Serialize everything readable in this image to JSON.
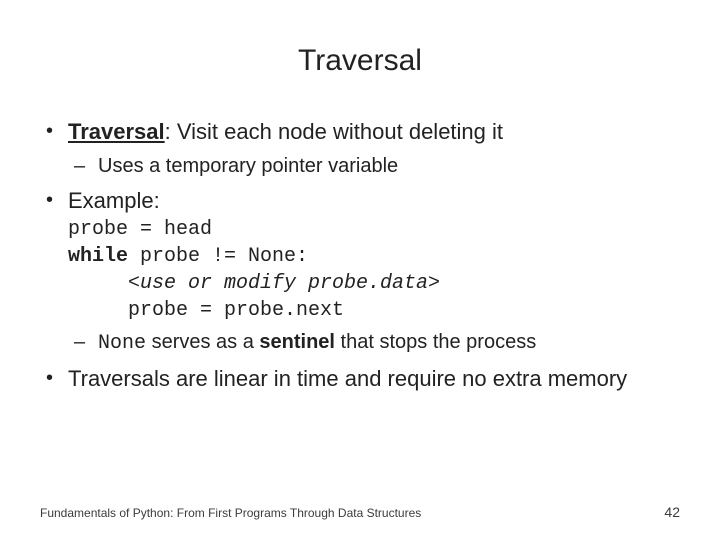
{
  "title": "Traversal",
  "bullets": {
    "b1_term": "Traversal",
    "b1_rest": ": Visit each node without deleting it",
    "b1_sub": "Uses a temporary pointer variable",
    "b2": "Example:",
    "code_l1": "probe = head",
    "code_l2a": "while",
    "code_l2b": " probe != None:",
    "code_l3": "     <use or modify probe.data>",
    "code_l4": "     probe = probe.next",
    "none_word": "None",
    "sentinel_pre": " serves as a ",
    "sentinel_bold": "sentinel",
    "sentinel_post": " that stops the process",
    "b3": "Traversals are linear in time and require no extra memory"
  },
  "footer": "Fundamentals of Python: From First Programs Through Data Structures",
  "page": "42"
}
